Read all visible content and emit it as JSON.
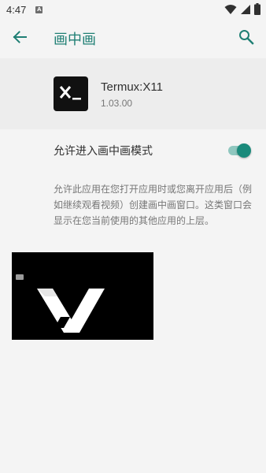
{
  "status_bar": {
    "time": "4:47",
    "notification_icon": "A"
  },
  "app_bar": {
    "title": "画中画",
    "back_icon": "arrow-back-icon",
    "search_icon": "search-icon"
  },
  "app_header": {
    "name": "Termux:X11",
    "version": "1.03.00"
  },
  "setting": {
    "label": "允许进入画中画模式",
    "enabled": true
  },
  "description": "允许此应用在您打开应用时或您离开应用后（例如继续观看视频）创建画中画窗口。这类窗口会显示在您当前使用的其他应用的上层。",
  "colors": {
    "accent": "#1f7f74",
    "toggle_thumb": "#1a8a7b",
    "toggle_track": "#8fc7bf"
  }
}
